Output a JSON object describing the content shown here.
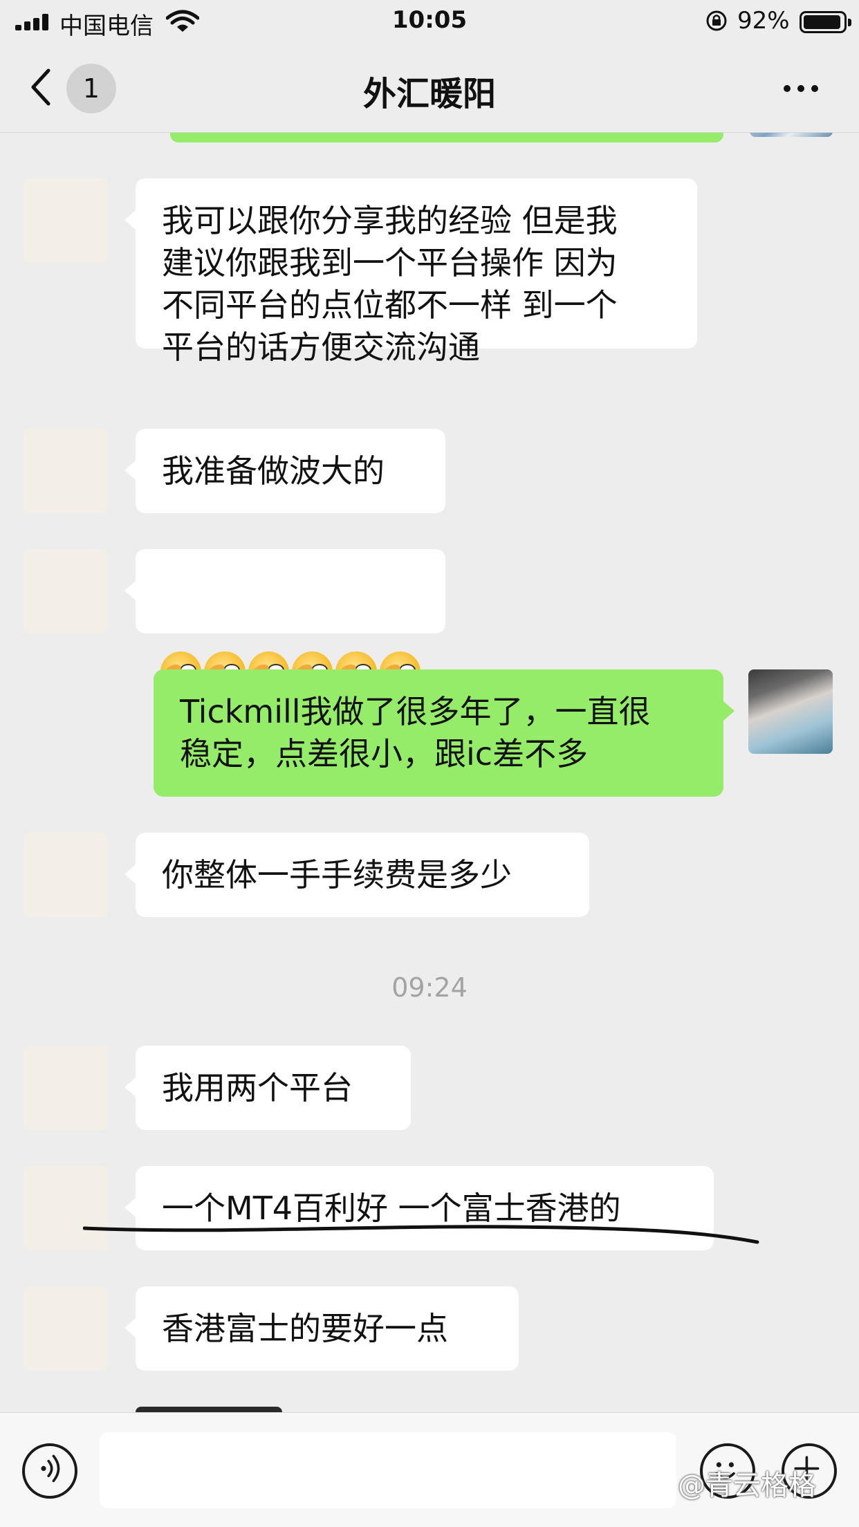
{
  "status_bar": {
    "carrier": "中国电信",
    "time": "10:05",
    "battery_percent": "92%",
    "battery_level": 0.92,
    "icons": [
      "signal-icon",
      "wifi-icon",
      "rotation-lock-icon",
      "battery-icon"
    ]
  },
  "nav": {
    "unread_count": "1",
    "title": "外汇暖阳",
    "icons": [
      "back-chevron-icon",
      "more-icon"
    ]
  },
  "chat": {
    "messages": [
      {
        "side": "left",
        "text": "我可以跟你分享我的经验 但是我\n建议你跟我到一个平台操作 因为\n不同平台的点位都不一样 到一个\n平台的话方便交流沟通"
      },
      {
        "side": "left",
        "text": "我准备做波大的"
      },
      {
        "side": "left",
        "emoji": "wink-emoji",
        "emoji_count": 6
      },
      {
        "side": "right",
        "text": "Tickmill我做了很多年了，一直很\n稳定，点差很小，跟ic差不多"
      },
      {
        "side": "left",
        "text": "你整体一手手续费是多少"
      },
      {
        "side": "left",
        "text": "我用两个平台"
      },
      {
        "side": "left",
        "text": "一个MT4百利好 一个富士香港的"
      },
      {
        "side": "left",
        "text": "香港富士的要好一点"
      }
    ],
    "time_divider": "09:24"
  },
  "input_bar": {
    "icons": [
      "voice-icon",
      "emoji-icon",
      "plus-icon"
    ],
    "watermark": "@青云格格"
  },
  "colors": {
    "background": "#ededed",
    "outgoing_bubble": "#95ec69",
    "incoming_bubble": "#ffffff",
    "timestamp": "#a3a3a3"
  }
}
